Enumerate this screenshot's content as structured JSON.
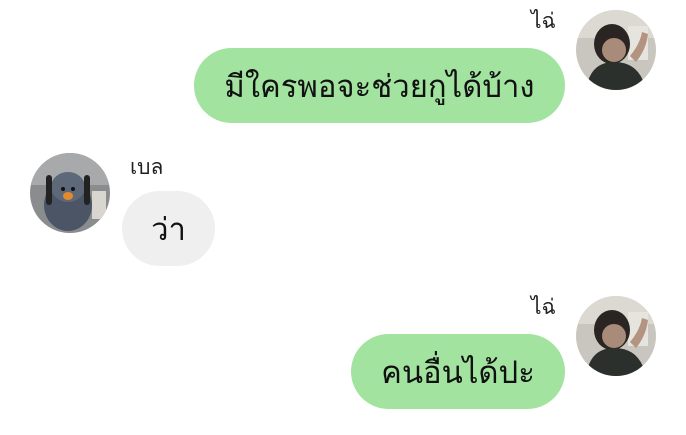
{
  "messages": [
    {
      "sender": "ไฉ่",
      "text": "มีใครพอจะช่วยกูได้บ้าง",
      "side": "right",
      "avatar_icon": "person-avatar-icon",
      "bubble_color": "#a2e3a0"
    },
    {
      "sender": "เบล",
      "text": "ว่า",
      "side": "left",
      "avatar_icon": "bird-plush-avatar-icon",
      "bubble_color": "#efefef"
    },
    {
      "sender": "ไฉ่",
      "text": "คนอื่นได้ปะ",
      "side": "right",
      "avatar_icon": "person-avatar-icon",
      "bubble_color": "#a2e3a0"
    }
  ]
}
